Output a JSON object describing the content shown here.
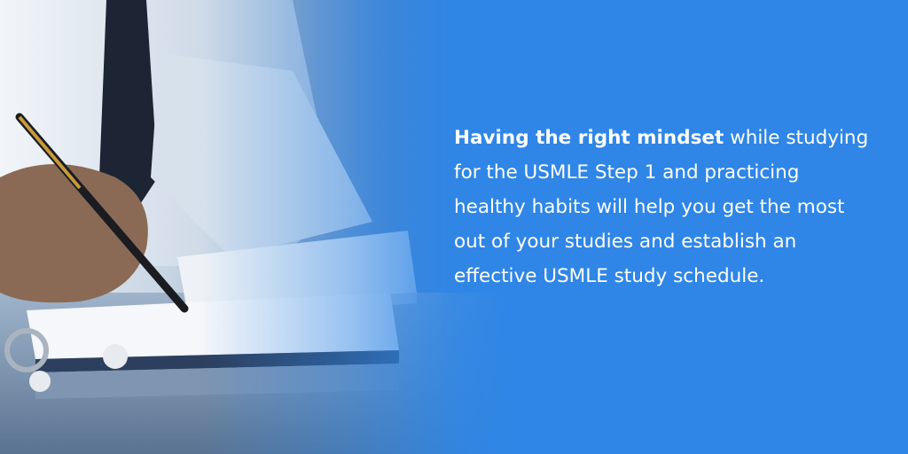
{
  "message": {
    "lead": "Having the right mindset",
    "body": " while studying for the USMLE Step 1 and practicing healthy habits will help you get the most out of your studies and establish an effective USMLE study schedule."
  },
  "colors": {
    "accent_blue": "#2f86e6",
    "text": "#ffffff"
  }
}
